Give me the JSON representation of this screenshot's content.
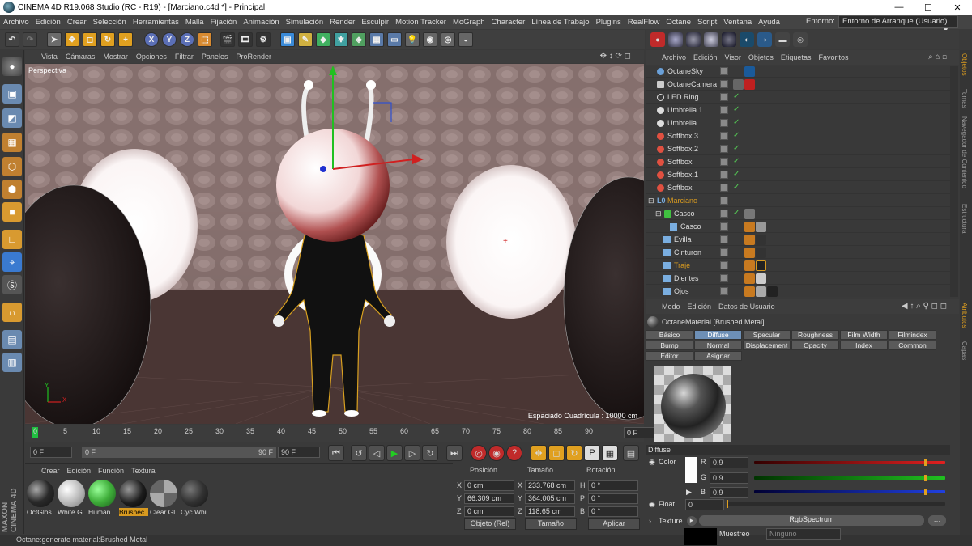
{
  "title_bar": {
    "title": "CINEMA 4D R19.068 Studio (RC - R19) - [Marciano.c4d *] - Principal"
  },
  "menu": [
    "Archivo",
    "Edición",
    "Crear",
    "Selección",
    "Herramientas",
    "Malla",
    "Fijación",
    "Animación",
    "Simulación",
    "Render",
    "Esculpir",
    "Motion Tracker",
    "MoGraph",
    "Character",
    "Línea de Trabajo",
    "Plugins",
    "RealFlow",
    "Octane",
    "Script",
    "Ventana",
    "Ayuda"
  ],
  "environment": {
    "label": "Entorno:",
    "value": "Entorno de Arranque (Usuario)"
  },
  "toolbar": {
    "axis_x": "X",
    "axis_y": "Y",
    "axis_z": "Z"
  },
  "viewport": {
    "menu": [
      "Vista",
      "Cámaras",
      "Mostrar",
      "Opciones",
      "Filtrar",
      "Paneles",
      "ProRender"
    ],
    "label": "Perspectiva",
    "grid_spacing": "Espaciado Cuadrícula : 10000 cm",
    "axis_x": "X",
    "axis_y": "Y"
  },
  "timeline": {
    "ticks": [
      "0",
      "5",
      "10",
      "15",
      "20",
      "25",
      "30",
      "35",
      "40",
      "45",
      "50",
      "55",
      "60",
      "65",
      "70",
      "75",
      "80",
      "85",
      "90"
    ],
    "frame_field": "0 F"
  },
  "transport": {
    "start": "0 F",
    "range_start": "0 F",
    "range_end": "90 F",
    "end": "90 F"
  },
  "materials": {
    "menu": [
      "Crear",
      "Edición",
      "Función",
      "Textura"
    ],
    "items": [
      {
        "label": "OctGlos",
        "color": "#2a2a2a"
      },
      {
        "label": "White G",
        "color": "#bdbdbd"
      },
      {
        "label": "Human",
        "color": "#3fae3a"
      },
      {
        "label": "Brushec",
        "color": "#1d1d1d",
        "selected": true
      },
      {
        "label": "Clear Gl",
        "color": "#8a8a8a"
      },
      {
        "label": "Cyc Whi",
        "color": "#333333"
      }
    ]
  },
  "coordinates": {
    "headers": {
      "pos": "Posición",
      "size": "Tamaño",
      "rot": "Rotación"
    },
    "rows": [
      {
        "axis": "X",
        "pos": "0 cm",
        "size_axis": "X",
        "size": "233.768 cm",
        "rot_axis": "H",
        "rot": "0 °"
      },
      {
        "axis": "Y",
        "pos": "66.309 cm",
        "size_axis": "Y",
        "size": "364.005 cm",
        "rot_axis": "P",
        "rot": "0 °"
      },
      {
        "axis": "Z",
        "pos": "0 cm",
        "size_axis": "Z",
        "size": "118.65 cm",
        "rot_axis": "B",
        "rot": "0 °"
      }
    ],
    "mode": "Objeto (Rel)",
    "size_mode": "Tamaño",
    "apply": "Aplicar"
  },
  "objects": {
    "menu": [
      "Archivo",
      "Edición",
      "Visor",
      "Objetos",
      "Etiquetas",
      "Favoritos"
    ],
    "items": [
      {
        "name": "OctaneSky",
        "icon_color": "#6aa0d8",
        "indent": 0
      },
      {
        "name": "OctaneCamera",
        "icon_color": "#cccccc",
        "indent": 0
      },
      {
        "name": "LED Ring",
        "icon_color": "#dddddd",
        "indent": 0
      },
      {
        "name": "Umbrella.1",
        "icon_color": "#dddddd",
        "indent": 0
      },
      {
        "name": "Umbrella",
        "icon_color": "#dddddd",
        "indent": 0
      },
      {
        "name": "Softbox.3",
        "icon_color": "#e05040",
        "indent": 0
      },
      {
        "name": "Softbox.2",
        "icon_color": "#e05040",
        "indent": 0
      },
      {
        "name": "Softbox",
        "icon_color": "#e05040",
        "indent": 0
      },
      {
        "name": "Softbox.1",
        "icon_color": "#e05040",
        "indent": 0
      },
      {
        "name": "Softbox",
        "icon_color": "#e05040",
        "indent": 0
      },
      {
        "name": "Marciano",
        "icon_color": "#7aaee0",
        "indent": 0,
        "highlight": true
      },
      {
        "name": "Casco",
        "icon_color": "#40c040",
        "indent": 1
      },
      {
        "name": "Casco",
        "icon_color": "#7aaee0",
        "indent": 2
      },
      {
        "name": "Evilla",
        "icon_color": "#7aaee0",
        "indent": 1
      },
      {
        "name": "Cinturon",
        "icon_color": "#7aaee0",
        "indent": 1
      },
      {
        "name": "Traje",
        "icon_color": "#7aaee0",
        "indent": 1,
        "highlight": true
      },
      {
        "name": "Dientes",
        "icon_color": "#7aaee0",
        "indent": 1
      },
      {
        "name": "Ojos",
        "icon_color": "#7aaee0",
        "indent": 1
      }
    ]
  },
  "attributes": {
    "menu": [
      "Modo",
      "Edición",
      "Datos de Usuario"
    ],
    "title": "OctaneMaterial [Brushed Metal]",
    "tabs": [
      "Básico",
      "Diffuse",
      "Specular",
      "Roughness",
      "Film Width",
      "Filmindex",
      "Bump",
      "Normal",
      "Displacement",
      "Opacity",
      "Index",
      "Common",
      "Editor",
      "Asignar"
    ],
    "selected_tab": "Diffuse",
    "section": "Diffuse",
    "color_label": "Color",
    "r_label": "R",
    "r": "0.9",
    "g_label": "G",
    "g": "0.9",
    "b_label": "B",
    "b": "0.9",
    "float_label": "Float",
    "float_value": "0",
    "texture_label": "Texture",
    "texture_value": "RgbSpectrum",
    "muestreo_label": "Muestreo",
    "muestreo_value": "Ninguno"
  },
  "right_tabs": [
    "Objetos",
    "Tomas",
    "Navegador de Contenido",
    "Estructura",
    "Atributos",
    "Capas"
  ],
  "status": "Octane:generate material:Brushed Metal",
  "branding": "MAXON CINEMA 4D"
}
